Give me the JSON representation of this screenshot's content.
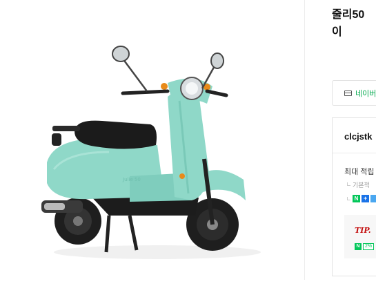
{
  "product": {
    "title_line1": "줄리50",
    "title_line2": "이",
    "image_alt": "mint scooter product photo"
  },
  "buy": {
    "naver_pay_label": "네이버",
    "icon": "card-icon"
  },
  "seller": {
    "name": "clcjstk",
    "points_title": "최대 적립",
    "points_sub": "기본적",
    "badges": [
      "N",
      "+"
    ]
  },
  "tip": {
    "label": "TIP.",
    "badges": [
      "N",
      "2%"
    ]
  },
  "colors": {
    "scooter_body": "#8fd8c8",
    "naver_green": "#03a94d",
    "tip_red": "#c40f0f"
  }
}
